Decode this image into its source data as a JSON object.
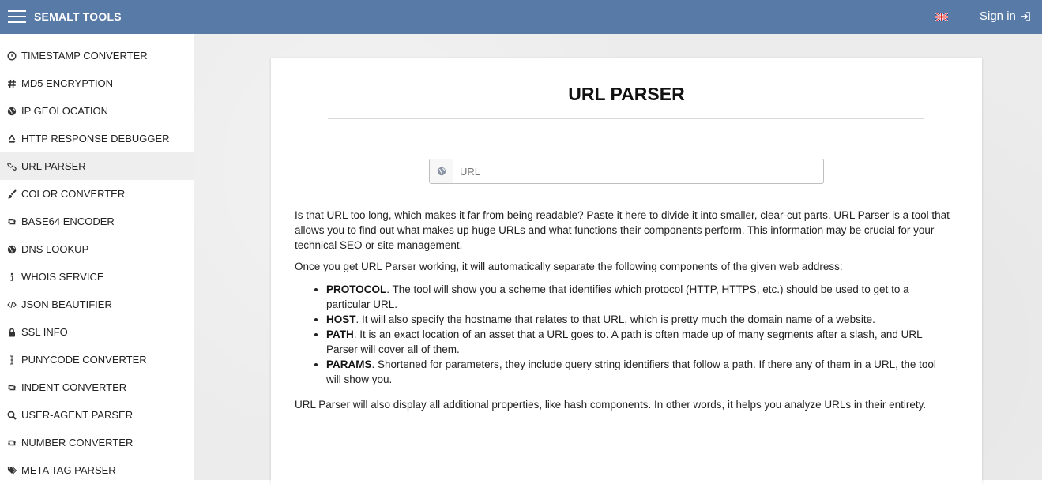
{
  "topbar": {
    "brand": "SEMALT TOOLS",
    "signin_label": "Sign in",
    "language_flag": "uk-flag-icon",
    "background_color": "#587aa7"
  },
  "sidebar": {
    "items": [
      {
        "label": "TIMESTAMP CONVERTER",
        "icon": "clock-icon"
      },
      {
        "label": "MD5 ENCRYPTION",
        "icon": "hash-icon"
      },
      {
        "label": "IP GEOLOCATION",
        "icon": "globe-icon"
      },
      {
        "label": "HTTP RESPONSE DEBUGGER",
        "icon": "recycle-icon"
      },
      {
        "label": "URL PARSER",
        "icon": "unlink-icon",
        "active": true
      },
      {
        "label": "COLOR CONVERTER",
        "icon": "paintbrush-icon"
      },
      {
        "label": "BASE64 ENCODER",
        "icon": "retweet-icon"
      },
      {
        "label": "DNS LOOKUP",
        "icon": "globe-icon"
      },
      {
        "label": "WHOIS SERVICE",
        "icon": "info-icon"
      },
      {
        "label": "JSON BEAUTIFIER",
        "icon": "code-icon"
      },
      {
        "label": "SSL INFO",
        "icon": "lock-icon"
      },
      {
        "label": "PUNYCODE CONVERTER",
        "icon": "text-cursor-icon"
      },
      {
        "label": "INDENT CONVERTER",
        "icon": "retweet-icon"
      },
      {
        "label": "USER-AGENT PARSER",
        "icon": "search-icon"
      },
      {
        "label": "NUMBER CONVERTER",
        "icon": "retweet-icon"
      },
      {
        "label": "META TAG PARSER",
        "icon": "tags-icon"
      }
    ]
  },
  "main": {
    "title": "URL PARSER",
    "url_input": {
      "placeholder": "URL",
      "value": ""
    },
    "intro": "Is that URL too long, which makes it far from being readable? Paste it here to divide it into smaller, clear-cut parts. URL Parser is a tool that allows you to find out what makes up huge URLs and what functions their components perform. This information may be crucial for your technical SEO or site management.",
    "lead": "Once you get URL Parser working, it will automatically separate the following components of the given web address:",
    "components": [
      {
        "term": "PROTOCOL",
        "text": ". The tool will show you a scheme that identifies which protocol (HTTP, HTTPS, etc.) should be used to get to a particular URL."
      },
      {
        "term": "HOST",
        "text": ". It will also specify the hostname that relates to that URL, which is pretty much the domain name of a website."
      },
      {
        "term": "PATH",
        "text": ". It is an exact location of an asset that a URL goes to. A path is often made up of many segments after a slash, and URL Parser will cover all of them."
      },
      {
        "term": "PARAMS",
        "text": ". Shortened for parameters, they include query string identifiers that follow a path. If there any of them in a URL, the tool will show you."
      }
    ],
    "outro": "URL Parser will also display all additional properties, like hash components. In other words, it helps you analyze URLs in their entirety."
  }
}
